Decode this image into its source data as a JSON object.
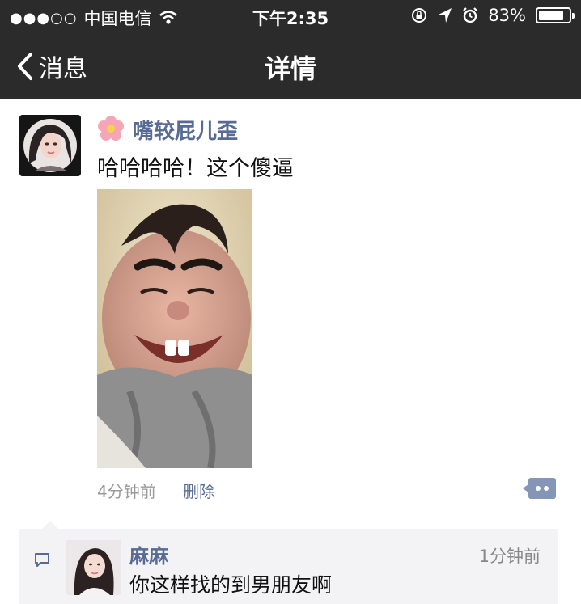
{
  "status_bar": {
    "signal": "●●●○○",
    "carrier": "中国电信",
    "time": "下午2:35",
    "battery": "83%",
    "battery_level": 0.83
  },
  "nav": {
    "back_label": "消息",
    "title": "详情"
  },
  "post": {
    "username": "嘴较屁儿歪",
    "text": "哈哈哈哈！这个傻逼",
    "time": "4分钟前",
    "delete_label": "删除"
  },
  "comment": {
    "author": "麻麻",
    "time": "1分钟前",
    "text": "你这样找的到男朋友啊"
  },
  "colors": {
    "header_bg": "#2b2b2b",
    "link_blue": "#576b95",
    "comment_bg": "#f3f3f5"
  },
  "icons": [
    "wifi-icon",
    "orientation-lock-icon",
    "location-arrow-icon",
    "alarm-icon",
    "battery-icon",
    "chevron-left-icon",
    "flower-icon",
    "more-options-icon",
    "comment-icon"
  ]
}
